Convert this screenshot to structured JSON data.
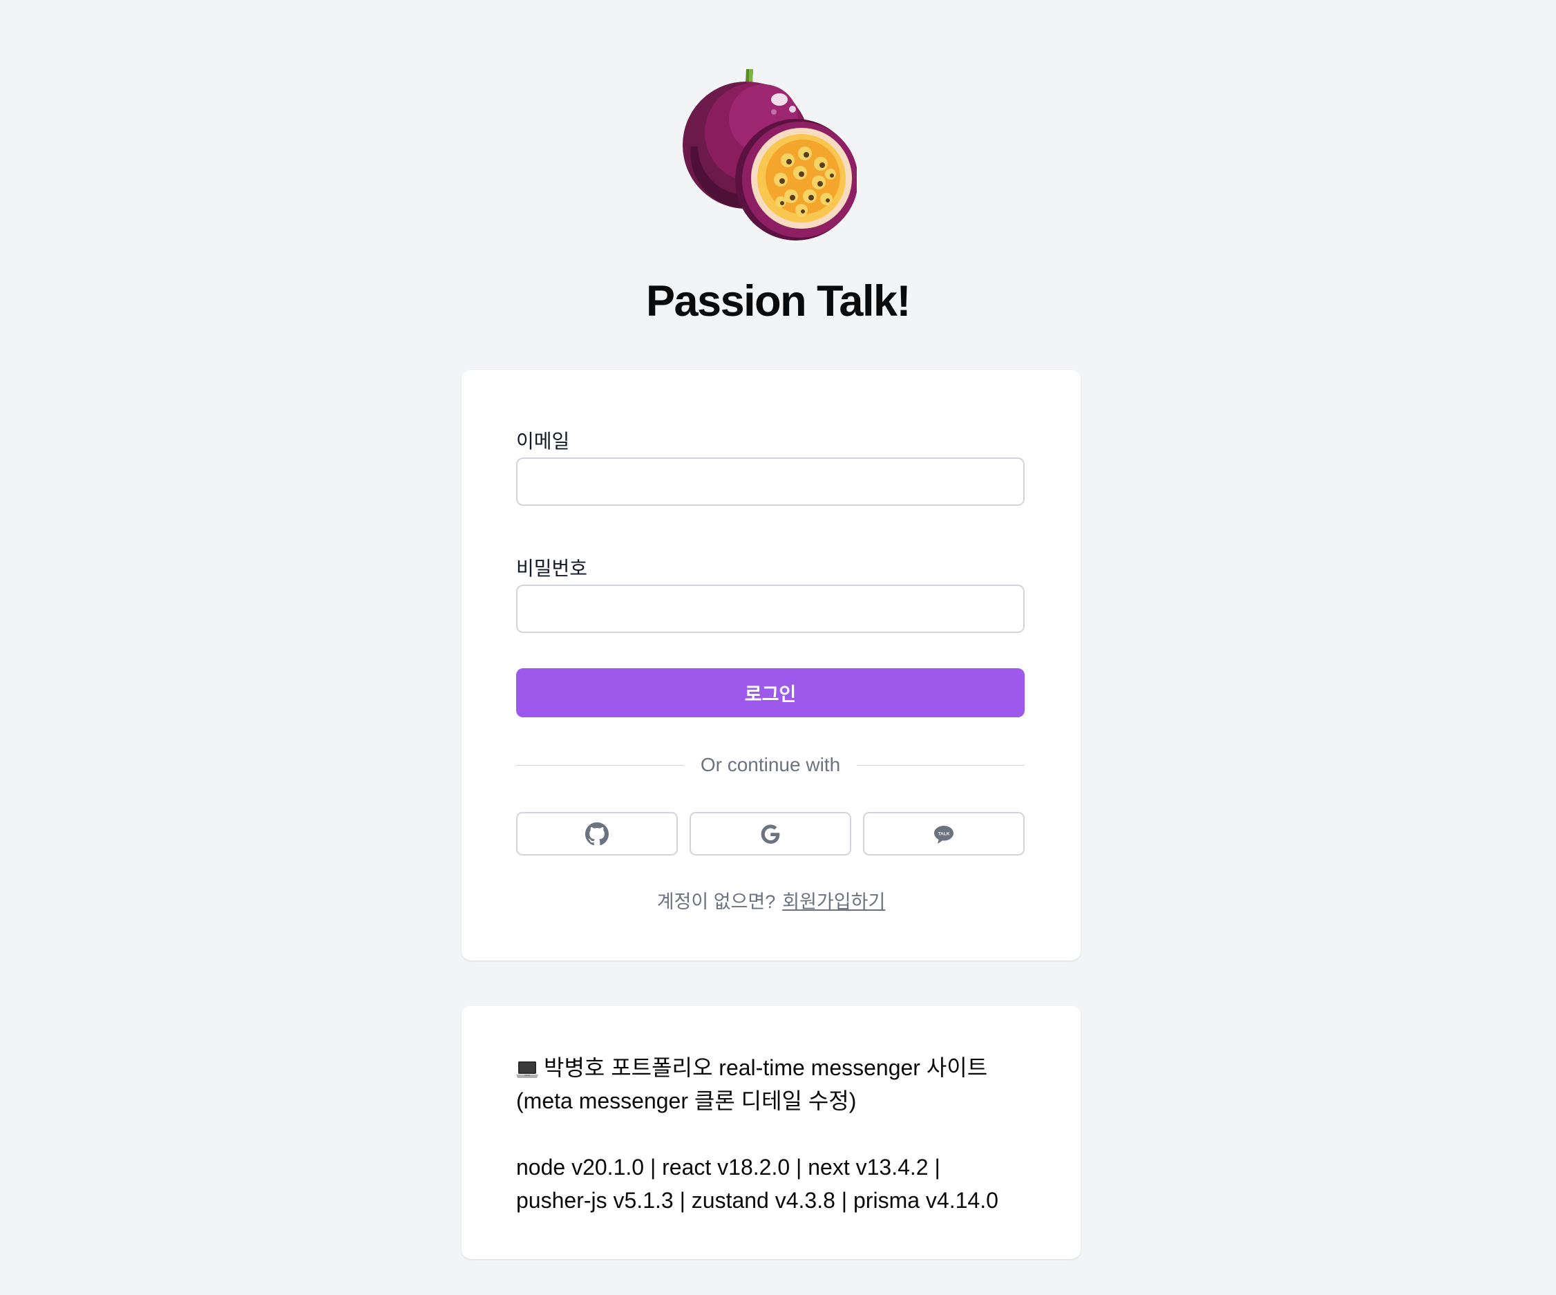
{
  "app": {
    "title": "Passion Talk!",
    "logo_icon": "passion-fruit-logo"
  },
  "login_form": {
    "email_label": "이메일",
    "email_value": "",
    "password_label": "비밀번호",
    "password_value": "",
    "login_button_label": "로그인",
    "divider_text": "Or continue with",
    "social_buttons": [
      {
        "name": "github",
        "icon": "github-icon"
      },
      {
        "name": "google",
        "icon": "google-icon"
      },
      {
        "name": "kakao",
        "icon": "kakao-talk-icon"
      }
    ],
    "signup_prompt": "계정이 없으면?",
    "signup_link": "회원가입하기"
  },
  "info": {
    "line1": "박병호 포트폴리오 real-time messenger 사이트",
    "line2": "(meta messenger 클론 디테일 수정)",
    "line3": "node v20.1.0 | react v18.2.0 | next v13.4.2 |",
    "line4": "pusher-js v5.1.3 | zustand v4.3.8 | prisma v4.14.0",
    "icon": "laptop-icon"
  },
  "colors": {
    "background": "#f3f4f6",
    "primary": "#9c59ec",
    "border": "#d1d5db",
    "muted_text": "#6b7280"
  }
}
